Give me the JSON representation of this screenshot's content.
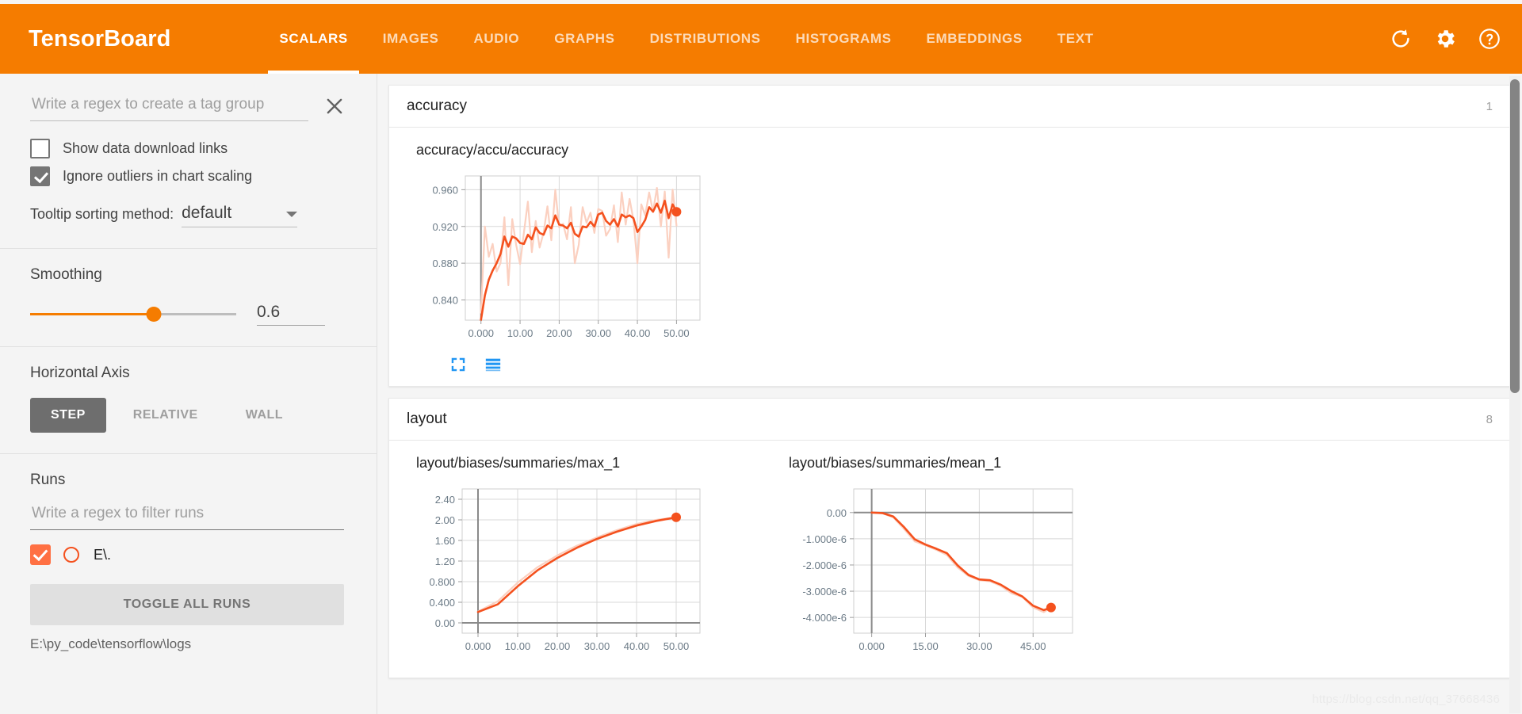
{
  "header": {
    "brand": "TensorBoard",
    "tabs": [
      {
        "label": "SCALARS",
        "active": true
      },
      {
        "label": "IMAGES",
        "active": false
      },
      {
        "label": "AUDIO",
        "active": false
      },
      {
        "label": "GRAPHS",
        "active": false
      },
      {
        "label": "DISTRIBUTIONS",
        "active": false
      },
      {
        "label": "HISTOGRAMS",
        "active": false
      },
      {
        "label": "EMBEDDINGS",
        "active": false
      },
      {
        "label": "TEXT",
        "active": false
      }
    ],
    "icons": [
      "refresh-icon",
      "settings-gear-icon",
      "help-icon"
    ],
    "accent_color": "#f57c00"
  },
  "sidebar": {
    "tag_regex": {
      "placeholder": "Write a regex to create a tag group",
      "value": ""
    },
    "checkboxes": [
      {
        "label": "Show data download links",
        "checked": false
      },
      {
        "label": "Ignore outliers in chart scaling",
        "checked": true
      }
    ],
    "tooltip_sort": {
      "label": "Tooltip sorting method:",
      "value": "default"
    },
    "smoothing": {
      "title": "Smoothing",
      "value": "0.6",
      "fraction": 0.6
    },
    "horizontal_axis": {
      "title": "Horizontal Axis",
      "options": [
        {
          "label": "STEP",
          "active": true
        },
        {
          "label": "RELATIVE",
          "active": false
        },
        {
          "label": "WALL",
          "active": false
        }
      ]
    },
    "runs": {
      "title": "Runs",
      "filter_placeholder": "Write a regex to filter runs",
      "filter_value": "",
      "items": [
        {
          "name": "E\\.",
          "checked": true,
          "color": "#f4511e"
        }
      ],
      "toggle_label": "TOGGLE ALL RUNS",
      "path": "E:\\py_code\\tensorflow\\logs"
    }
  },
  "main": {
    "groups": [
      {
        "name": "accuracy",
        "count": "1"
      },
      {
        "name": "layout",
        "count": "8"
      }
    ]
  },
  "watermark": "https://blog.csdn.net/qq_37668436",
  "chart_data": [
    {
      "type": "line",
      "title": "accuracy/accu/accuracy",
      "xlabel": "",
      "ylabel": "",
      "xticks": [
        "0.000",
        "10.00",
        "20.00",
        "30.00",
        "40.00",
        "50.00"
      ],
      "yticks": [
        "0.840",
        "0.880",
        "0.920",
        "0.960"
      ],
      "xlim": [
        -4,
        56
      ],
      "ylim": [
        0.818,
        0.975
      ],
      "grid": true,
      "legend": "none",
      "series": [
        {
          "name": "E\\. (raw)",
          "color": "#fbd0c0",
          "x": [
            0,
            1,
            2,
            3,
            4,
            5,
            6,
            7,
            8,
            9,
            10,
            11,
            12,
            13,
            14,
            15,
            16,
            17,
            18,
            19,
            20,
            21,
            22,
            23,
            24,
            25,
            26,
            27,
            28,
            29,
            30,
            31,
            32,
            33,
            34,
            35,
            36,
            37,
            38,
            39,
            40,
            41,
            42,
            43,
            44,
            45,
            46,
            47,
            48,
            49,
            50
          ],
          "y": [
            0.826,
            0.92,
            0.887,
            0.901,
            0.871,
            0.88,
            0.93,
            0.856,
            0.928,
            0.9,
            0.879,
            0.914,
            0.947,
            0.892,
            0.926,
            0.897,
            0.913,
            0.942,
            0.905,
            0.96,
            0.919,
            0.923,
            0.906,
            0.941,
            0.88,
            0.9,
            0.941,
            0.924,
            0.935,
            0.913,
            0.939,
            0.937,
            0.91,
            0.917,
            0.943,
            0.903,
            0.957,
            0.922,
            0.95,
            0.927,
            0.88,
            0.944,
            0.932,
            0.957,
            0.936,
            0.962,
            0.92,
            0.958,
            0.886,
            0.96,
            0.921
          ]
        },
        {
          "name": "E\\. (smoothed)",
          "color": "#f4511e",
          "x": [
            0,
            1,
            2,
            3,
            4,
            5,
            6,
            7,
            8,
            9,
            10,
            11,
            12,
            13,
            14,
            15,
            16,
            17,
            18,
            19,
            20,
            21,
            22,
            23,
            24,
            25,
            26,
            27,
            28,
            29,
            30,
            31,
            32,
            33,
            34,
            35,
            36,
            37,
            38,
            39,
            40,
            41,
            42,
            43,
            44,
            45,
            46,
            47,
            48,
            49,
            50
          ],
          "y": [
            0.818,
            0.845,
            0.862,
            0.872,
            0.88,
            0.89,
            0.909,
            0.898,
            0.909,
            0.907,
            0.902,
            0.901,
            0.911,
            0.906,
            0.919,
            0.913,
            0.911,
            0.921,
            0.918,
            0.932,
            0.922,
            0.921,
            0.918,
            0.924,
            0.912,
            0.909,
            0.92,
            0.919,
            0.925,
            0.92,
            0.933,
            0.935,
            0.926,
            0.922,
            0.928,
            0.92,
            0.933,
            0.93,
            0.932,
            0.929,
            0.914,
            0.92,
            0.927,
            0.941,
            0.936,
            0.945,
            0.935,
            0.948,
            0.929,
            0.944,
            0.936
          ]
        }
      ],
      "end_marker": {
        "x": 50,
        "y": 0.936,
        "color": "#f4511e"
      }
    },
    {
      "type": "line",
      "title": "layout/biases/summaries/max_1",
      "xlabel": "",
      "ylabel": "",
      "xticks": [
        "0.000",
        "10.00",
        "20.00",
        "30.00",
        "40.00",
        "50.00"
      ],
      "yticks": [
        "0.00",
        "0.400",
        "0.800",
        "1.20",
        "1.60",
        "2.00",
        "2.40"
      ],
      "xlim": [
        -4,
        56
      ],
      "ylim": [
        -0.2,
        2.6
      ],
      "grid": true,
      "legend": "none",
      "series": [
        {
          "name": "E\\. (raw)",
          "color": "#fbd0c0",
          "x": [
            0,
            5,
            10,
            15,
            20,
            25,
            30,
            35,
            40,
            45,
            50
          ],
          "y": [
            0.22,
            0.42,
            0.78,
            1.08,
            1.31,
            1.5,
            1.66,
            1.8,
            1.92,
            2.0,
            2.05
          ]
        },
        {
          "name": "E\\. (smoothed)",
          "color": "#f4511e",
          "x": [
            0,
            5,
            10,
            15,
            20,
            25,
            30,
            35,
            40,
            45,
            50
          ],
          "y": [
            0.21,
            0.36,
            0.71,
            1.02,
            1.26,
            1.46,
            1.63,
            1.77,
            1.89,
            1.98,
            2.05
          ]
        }
      ],
      "end_marker": {
        "x": 50,
        "y": 2.05,
        "color": "#f4511e"
      }
    },
    {
      "type": "line",
      "title": "layout/biases/summaries/mean_1",
      "xlabel": "",
      "ylabel": "",
      "xticks": [
        "0.000",
        "15.00",
        "30.00",
        "45.00"
      ],
      "yticks": [
        "0.00",
        "-1.000e-6",
        "-2.000e-6",
        "-3.000e-6",
        "-4.000e-6"
      ],
      "xlim": [
        -5,
        56
      ],
      "ylim": [
        -4.6e-06,
        9e-07
      ],
      "grid": true,
      "legend": "none",
      "series": [
        {
          "name": "E\\. (raw)",
          "color": "#fbd0c0",
          "x": [
            0,
            3,
            6,
            9,
            12,
            15,
            18,
            21,
            24,
            27,
            30,
            33,
            36,
            39,
            42,
            45,
            48,
            50
          ],
          "y": [
            0,
            -3e-08,
            -1.8e-07,
            -6.2e-07,
            -1.1e-06,
            -1.25e-06,
            -1.42e-06,
            -1.62e-06,
            -2.1e-06,
            -2.42e-06,
            -2.58e-06,
            -2.62e-06,
            -2.8e-06,
            -3.08e-06,
            -3.22e-06,
            -3.62e-06,
            -3.8e-06,
            -3.62e-06
          ]
        },
        {
          "name": "E\\. (smoothed)",
          "color": "#f4511e",
          "x": [
            0,
            3,
            6,
            9,
            12,
            15,
            18,
            21,
            24,
            27,
            30,
            33,
            36,
            39,
            42,
            45,
            48,
            50
          ],
          "y": [
            0,
            -2e-08,
            -1.5e-07,
            -5.5e-07,
            -1.02e-06,
            -1.22e-06,
            -1.38e-06,
            -1.55e-06,
            -2.02e-06,
            -2.38e-06,
            -2.55e-06,
            -2.58e-06,
            -2.75e-06,
            -3e-06,
            -3.2e-06,
            -3.55e-06,
            -3.72e-06,
            -3.62e-06
          ]
        }
      ],
      "end_marker": {
        "x": 50,
        "y": -3.62e-06,
        "color": "#f4511e"
      }
    }
  ]
}
